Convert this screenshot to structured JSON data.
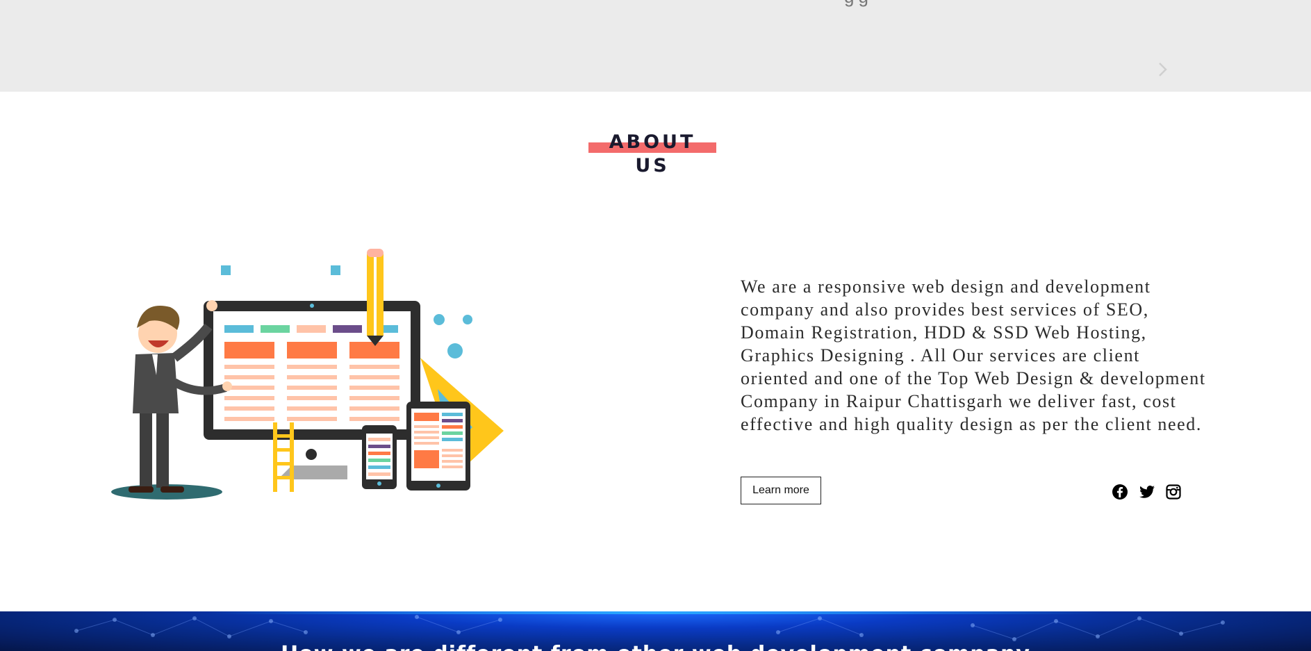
{
  "carousel": {
    "partial_text": "gg",
    "next_icon": "chevron-right-icon"
  },
  "about": {
    "heading": "ABOUT US",
    "accent_color": "#f36b6b",
    "description": "We are a responsive web design and development company and also provides best services of SEO, Domain Registration, HDD & SSD Web Hosting, Graphics Designing . All Our services are client oriented and one of the Top Web Design & development Company in Raipur Chattisgarh we deliver fast, cost effective and high quality design as per the client need.",
    "learn_more_label": "Learn more",
    "social": [
      {
        "icon": "facebook-icon"
      },
      {
        "icon": "twitter-icon"
      },
      {
        "icon": "instagram-icon"
      }
    ]
  },
  "banner": {
    "heading": "How we are different from other web development company"
  }
}
